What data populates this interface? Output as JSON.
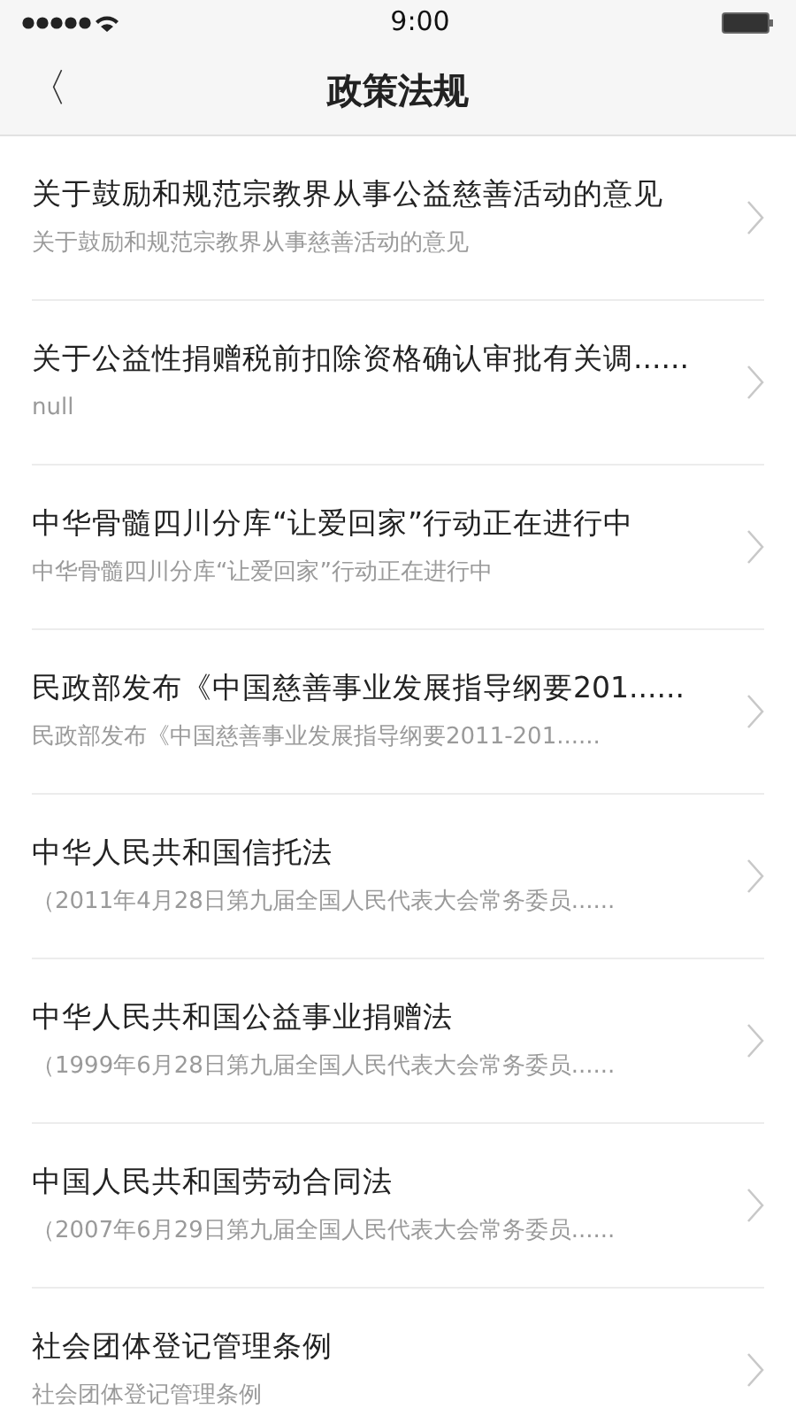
{
  "status_bar": {
    "time": "9:00"
  },
  "nav": {
    "back": "〈",
    "title": "政策法规"
  },
  "items": [
    {
      "title": "关于鼓励和规范宗教界从事公益慈善活动的意见",
      "subtitle": "关于鼓励和规范宗教界从事慈善活动的意见"
    },
    {
      "title": "关于公益性捐赠税前扣除资格确认审批有关调......",
      "subtitle": "null"
    },
    {
      "title": "中华骨髓四川分库“让爱回家”行动正在进行中",
      "subtitle": "中华骨髓四川分库“让爱回家”行动正在进行中"
    },
    {
      "title": "民政部发布《中国慈善事业发展指导纲要201......",
      "subtitle": "民政部发布《中国慈善事业发展指导纲要2011-201......"
    },
    {
      "title": "中华人民共和国信托法",
      "subtitle": "（2011年4月28日第九届全国人民代表大会常务委员......"
    },
    {
      "title": "中华人民共和国公益事业捐赠法",
      "subtitle": "（1999年6月28日第九届全国人民代表大会常务委员......"
    },
    {
      "title": "中国人民共和国劳动合同法",
      "subtitle": "（2007年6月29日第九届全国人民代表大会常务委员......"
    },
    {
      "title": "社会团体登记管理条例",
      "subtitle": "社会团体登记管理条例"
    }
  ]
}
